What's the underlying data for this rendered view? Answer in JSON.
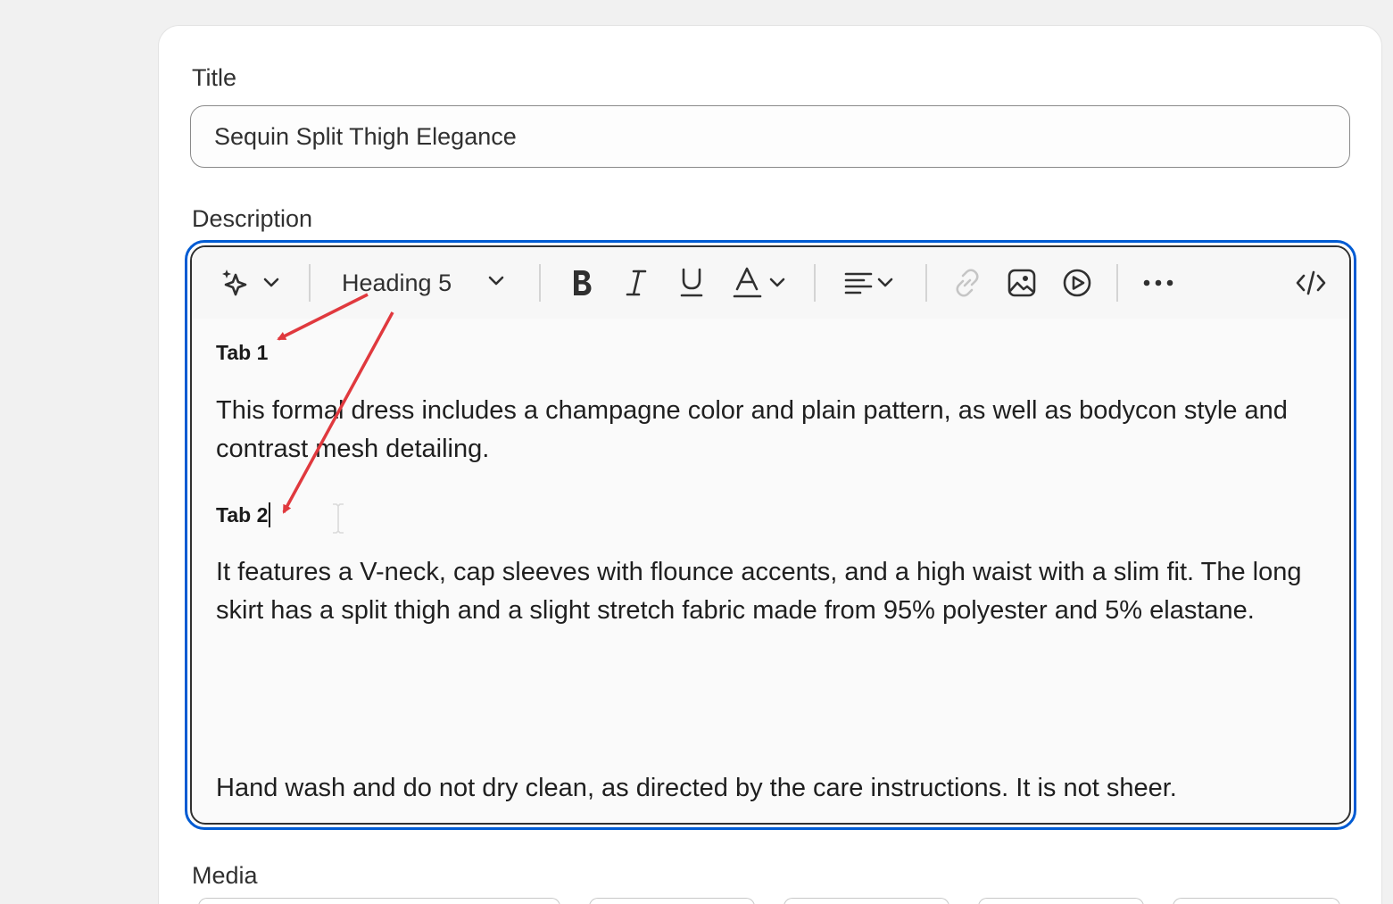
{
  "fields": {
    "title_label": "Title",
    "title_value": "Sequin Split Thigh Elegance",
    "description_label": "Description",
    "media_label": "Media"
  },
  "toolbar": {
    "heading_select": "Heading 5",
    "icons": [
      "magic-sparkle-icon",
      "chevron-down-icon",
      "bold-icon",
      "italic-icon",
      "underline-icon",
      "text-color-icon",
      "align-left-icon",
      "link-icon",
      "image-icon",
      "video-icon",
      "more-icon",
      "code-view-icon"
    ]
  },
  "content": {
    "tab1": "Tab 1",
    "para1": "This formal dress includes a champagne color and plain pattern, as well as bodycon style and contrast mesh detailing.",
    "tab2": "Tab 2",
    "para2": "It features a V-neck, cap sleeves with flounce accents, and a high waist with a slim fit. The long skirt has a split thigh and a slight stretch fabric made from 95% polyester and 5% elastane.",
    "para3": "Hand wash and do not dry clean, as directed by the care instructions. It is not sheer."
  },
  "colors": {
    "focus_ring": "#005bd3",
    "annotation_arrow": "#e0393e"
  }
}
